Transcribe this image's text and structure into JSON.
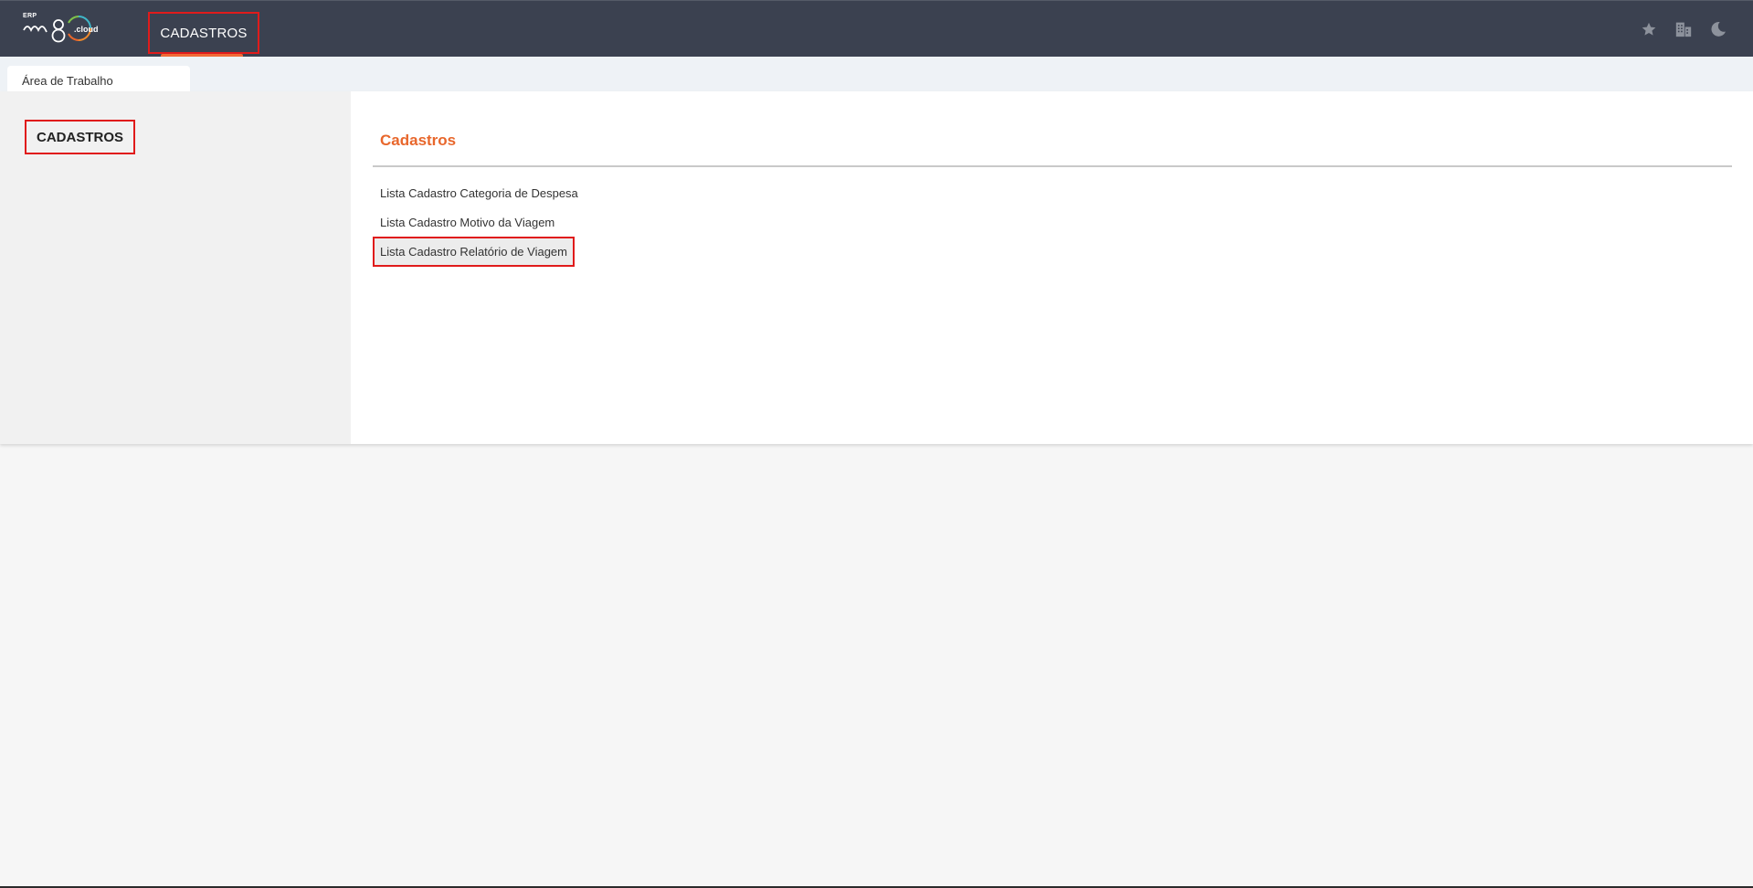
{
  "brand": {
    "erp": "ERP",
    "wordmark": "m8",
    "cloud": ".cloud"
  },
  "topnav": {
    "items": [
      {
        "label": "CADASTROS"
      }
    ],
    "icons": [
      "star-icon",
      "building-icon",
      "moon-icon"
    ]
  },
  "tabs": [
    {
      "label": "Área de Trabalho"
    }
  ],
  "sidebar": {
    "items": [
      {
        "label": "CADASTROS"
      }
    ]
  },
  "section": {
    "title": "Cadastros",
    "links": [
      {
        "label": "Lista Cadastro Categoria de Despesa"
      },
      {
        "label": "Lista Cadastro Motivo da Viagem"
      },
      {
        "label": "Lista Cadastro Relatório de Viagem"
      }
    ]
  },
  "colors": {
    "topbar": "#3b4150",
    "accent": "#e8672c",
    "highlight_border": "#e01b1b"
  }
}
